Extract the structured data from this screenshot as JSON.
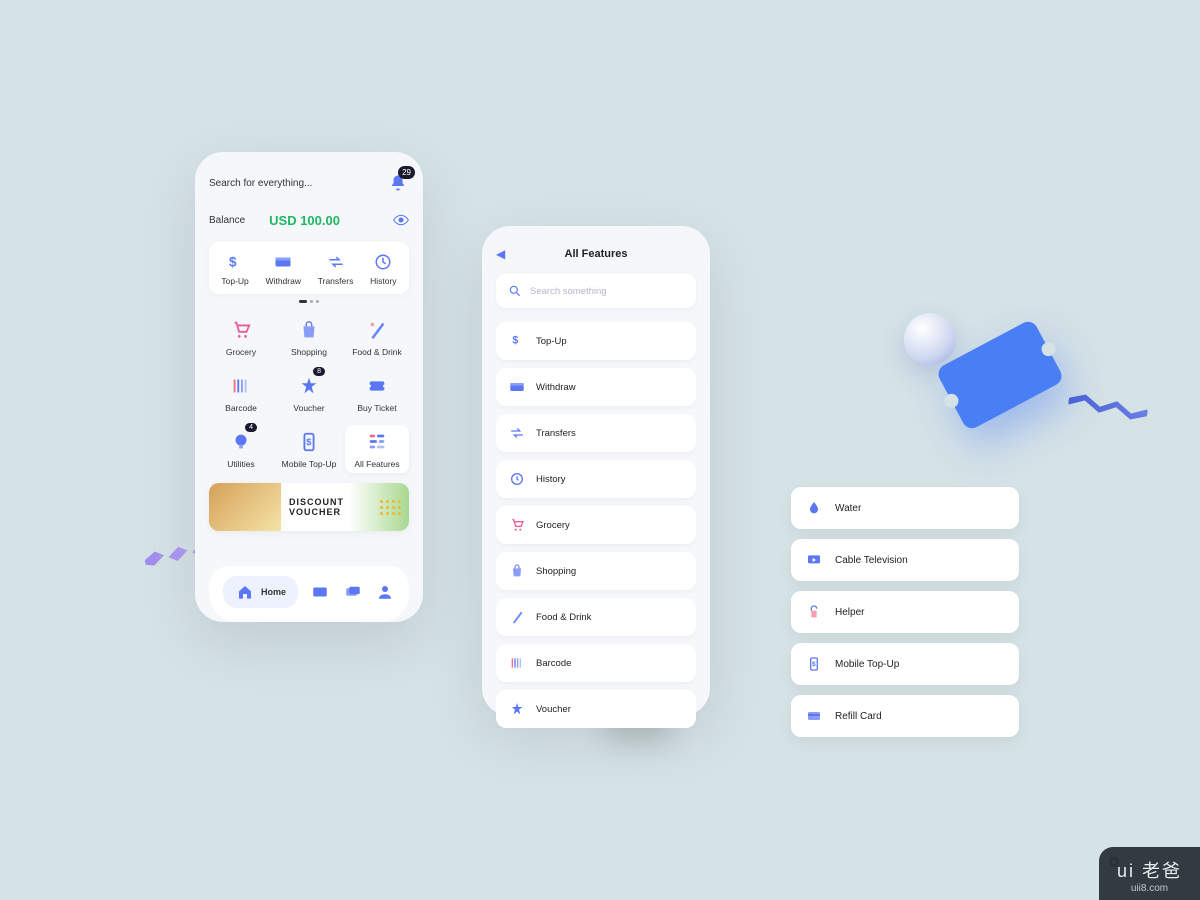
{
  "phone1": {
    "search_placeholder": "Search for everything...",
    "notif_count": "29",
    "balance_label": "Balance",
    "balance_value": "USD 100.00",
    "quick_actions": [
      {
        "label": "Top-Up",
        "icon": "dollar-icon"
      },
      {
        "label": "Withdraw",
        "icon": "wallet-icon"
      },
      {
        "label": "Transfers",
        "icon": "transfer-icon"
      },
      {
        "label": "History",
        "icon": "clock-icon"
      }
    ],
    "categories": [
      {
        "label": "Grocery",
        "icon": "cart-icon"
      },
      {
        "label": "Shopping",
        "icon": "bag-icon"
      },
      {
        "label": "Food & Drink",
        "icon": "food-icon"
      },
      {
        "label": "Barcode",
        "icon": "barcode-icon"
      },
      {
        "label": "Voucher",
        "icon": "voucher-icon",
        "badge": "8"
      },
      {
        "label": "Buy Ticket",
        "icon": "ticket-icon"
      },
      {
        "label": "Utilities",
        "icon": "bulb-icon",
        "badge": "4"
      },
      {
        "label": "Mobile Top-Up",
        "icon": "phone-icon"
      },
      {
        "label": "All Features",
        "icon": "grid-icon",
        "highlighted": true
      }
    ],
    "banner_line1": "DISCOUNT",
    "banner_line2": "VOUCHER",
    "tab_home": "Home"
  },
  "phone2": {
    "title": "All Features",
    "search_placeholder": "Search something",
    "features": [
      {
        "label": "Top-Up",
        "icon": "dollar-icon"
      },
      {
        "label": "Withdraw",
        "icon": "wallet-icon"
      },
      {
        "label": "Transfers",
        "icon": "transfer-icon"
      },
      {
        "label": "History",
        "icon": "clock-icon"
      },
      {
        "label": "Grocery",
        "icon": "cart-icon"
      },
      {
        "label": "Shopping",
        "icon": "bag-icon"
      },
      {
        "label": "Food & Drink",
        "icon": "food-icon"
      },
      {
        "label": "Barcode",
        "icon": "barcode-icon"
      },
      {
        "label": "Voucher",
        "icon": "voucher-icon"
      }
    ]
  },
  "right_cards": [
    {
      "label": "Water",
      "icon": "water-icon"
    },
    {
      "label": "Cable Television",
      "icon": "tv-icon"
    },
    {
      "label": "Helper",
      "icon": "helper-icon"
    },
    {
      "label": "Mobile Top-Up",
      "icon": "phone-icon"
    },
    {
      "label": "Refill Card",
      "icon": "card-icon"
    }
  ],
  "watermark": {
    "brand": "ui 老爸",
    "url": "uii8.com"
  },
  "colors": {
    "accent": "#5b77f5",
    "balance": "#1eb862"
  }
}
